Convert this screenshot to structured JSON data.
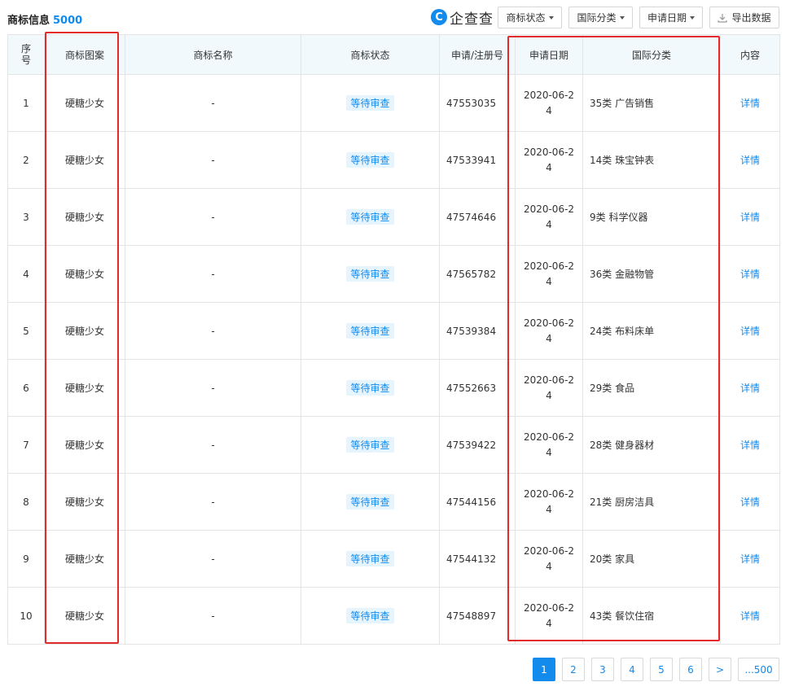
{
  "header": {
    "title": "商标信息",
    "count": "5000",
    "logo_mark": "C",
    "logo_text": "企查查",
    "filters": [
      "商标状态",
      "国际分类",
      "申请日期"
    ],
    "export_label": "导出数据",
    "export_icon": "download-icon"
  },
  "table": {
    "headers": [
      "序号",
      "商标图案",
      "商标名称",
      "商标状态",
      "申请/注册号",
      "申请日期",
      "国际分类",
      "内容"
    ],
    "rows": [
      {
        "index": "1",
        "image": "硬糖少女",
        "name": "-",
        "status": "等待审查",
        "reg_no": "47553035",
        "date_a": "2020-06-2",
        "date_b": "4",
        "class": "35类 广告销售",
        "action": "详情"
      },
      {
        "index": "2",
        "image": "硬糖少女",
        "name": "-",
        "status": "等待审查",
        "reg_no": "47533941",
        "date_a": "2020-06-2",
        "date_b": "4",
        "class": "14类 珠宝钟表",
        "action": "详情"
      },
      {
        "index": "3",
        "image": "硬糖少女",
        "name": "-",
        "status": "等待审查",
        "reg_no": "47574646",
        "date_a": "2020-06-2",
        "date_b": "4",
        "class": "9类 科学仪器",
        "action": "详情"
      },
      {
        "index": "4",
        "image": "硬糖少女",
        "name": "-",
        "status": "等待审查",
        "reg_no": "47565782",
        "date_a": "2020-06-2",
        "date_b": "4",
        "class": "36类 金融物管",
        "action": "详情"
      },
      {
        "index": "5",
        "image": "硬糖少女",
        "name": "-",
        "status": "等待审查",
        "reg_no": "47539384",
        "date_a": "2020-06-2",
        "date_b": "4",
        "class": "24类 布料床单",
        "action": "详情"
      },
      {
        "index": "6",
        "image": "硬糖少女",
        "name": "-",
        "status": "等待审查",
        "reg_no": "47552663",
        "date_a": "2020-06-2",
        "date_b": "4",
        "class": "29类 食品",
        "action": "详情"
      },
      {
        "index": "7",
        "image": "硬糖少女",
        "name": "-",
        "status": "等待审查",
        "reg_no": "47539422",
        "date_a": "2020-06-2",
        "date_b": "4",
        "class": "28类 健身器材",
        "action": "详情"
      },
      {
        "index": "8",
        "image": "硬糖少女",
        "name": "-",
        "status": "等待审查",
        "reg_no": "47544156",
        "date_a": "2020-06-2",
        "date_b": "4",
        "class": "21类 厨房洁具",
        "action": "详情"
      },
      {
        "index": "9",
        "image": "硬糖少女",
        "name": "-",
        "status": "等待审查",
        "reg_no": "47544132",
        "date_a": "2020-06-2",
        "date_b": "4",
        "class": "20类 家具",
        "action": "详情"
      },
      {
        "index": "10",
        "image": "硬糖少女",
        "name": "-",
        "status": "等待审查",
        "reg_no": "47548897",
        "date_a": "2020-06-2",
        "date_b": "4",
        "class": "43类 餐饮住宿",
        "action": "详情"
      }
    ]
  },
  "pagination": {
    "pages": [
      "1",
      "2",
      "3",
      "4",
      "5",
      "6"
    ],
    "active": "1",
    "next": ">",
    "last": "...500"
  },
  "colors": {
    "accent": "#128bed",
    "highlight_box": "#e32b2b",
    "header_bg": "#f2f9fc",
    "badge_bg": "#e6f4fd"
  }
}
